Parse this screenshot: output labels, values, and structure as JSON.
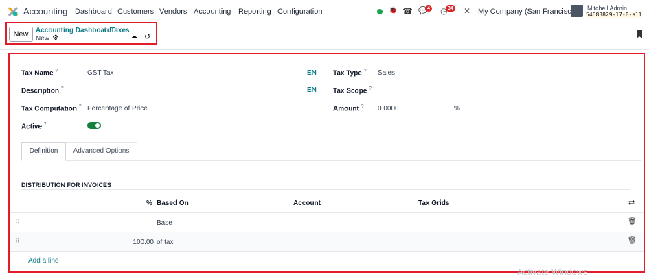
{
  "navbar": {
    "app": "Accounting",
    "menu": [
      "Dashboard",
      "Customers",
      "Vendors",
      "Accounting",
      "Reporting",
      "Configuration"
    ],
    "messages_count": "4",
    "activities_count": "34",
    "company": "My Company (San Francisco)",
    "user": "Mitchell Admin",
    "database": "54683829-17-0-all",
    "accent": "#0e7c86"
  },
  "control": {
    "new_button": "New",
    "breadcrumb": [
      "Accounting Dashboard",
      "Taxes"
    ],
    "record": "New"
  },
  "form": {
    "tax_name_label": "Tax Name",
    "tax_name": "GST Tax",
    "lang1": "EN",
    "description_label": "Description",
    "lang2": "EN",
    "computation_label": "Tax Computation",
    "computation": "Percentage of Price",
    "active_label": "Active",
    "active": true,
    "tax_type_label": "Tax Type",
    "tax_type": "Sales",
    "tax_scope_label": "Tax Scope",
    "amount_label": "Amount",
    "amount": "0.0000",
    "amount_unit": "%",
    "help": "?"
  },
  "tabs": [
    "Definition",
    "Advanced Options"
  ],
  "distribution": {
    "title": "DISTRIBUTION FOR INVOICES",
    "columns": [
      "%",
      "Based On",
      "Account",
      "Tax Grids"
    ],
    "rows": [
      {
        "percent": "",
        "based_on": "Base"
      },
      {
        "percent": "100.00",
        "based_on": "of tax"
      }
    ],
    "add_line": "Add a line"
  },
  "watermark": "Activate Windows"
}
